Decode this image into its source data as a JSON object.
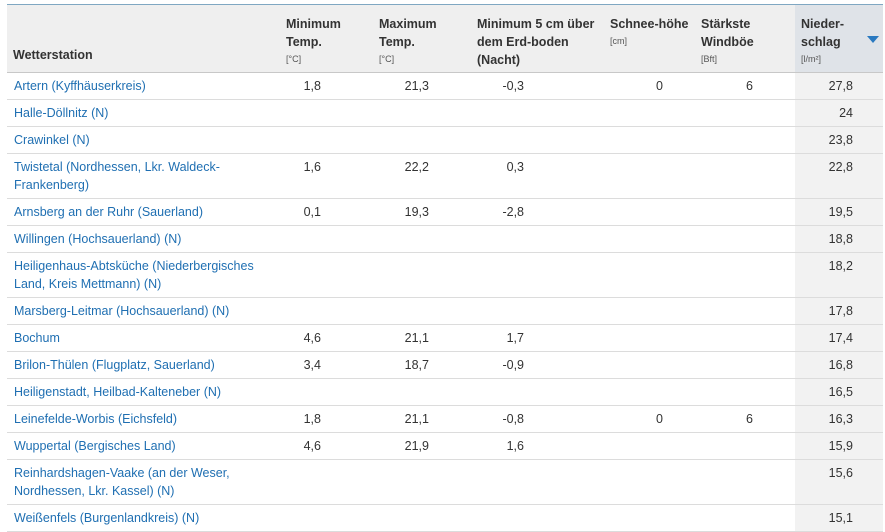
{
  "header": {
    "station": "Wetterstation",
    "min_temp": "Minimum Temp.",
    "min_temp_unit": "[°C]",
    "max_temp": "Maximum Temp.",
    "max_temp_unit": "[°C]",
    "min_5cm": "Minimum 5 cm über dem Erd-boden (Nacht)",
    "snow": "Schnee-höhe",
    "snow_unit": "[cm]",
    "wind": "Stärkste Windböe",
    "wind_unit": "[Bft]",
    "rain": "Nieder-schlag",
    "rain_unit": "[l/m²]",
    "sort_icon": "sort-descending-arrow",
    "colors": {
      "link": "#1f6fb2",
      "sort_arrow": "#2a79c0",
      "header_bg": "#efefef"
    }
  },
  "rows": [
    {
      "station": "Artern (Kyffhäuserkreis)",
      "min": "1,8",
      "max": "21,3",
      "min5": "-0,3",
      "snow": "0",
      "wind": "6",
      "rain": "27,8"
    },
    {
      "station": "Halle-Döllnitz (N)",
      "min": "",
      "max": "",
      "min5": "",
      "snow": "",
      "wind": "",
      "rain": "24"
    },
    {
      "station": "Crawinkel (N)",
      "min": "",
      "max": "",
      "min5": "",
      "snow": "",
      "wind": "",
      "rain": "23,8"
    },
    {
      "station": "Twistetal (Nordhessen, Lkr. Waldeck-Frankenberg)",
      "min": "1,6",
      "max": "22,2",
      "min5": "0,3",
      "snow": "",
      "wind": "",
      "rain": "22,8"
    },
    {
      "station": "Arnsberg an der Ruhr (Sauerland)",
      "min": "0,1",
      "max": "19,3",
      "min5": "-2,8",
      "snow": "",
      "wind": "",
      "rain": "19,5"
    },
    {
      "station": "Willingen (Hochsauerland) (N)",
      "min": "",
      "max": "",
      "min5": "",
      "snow": "",
      "wind": "",
      "rain": "18,8"
    },
    {
      "station": "Heiligenhaus-Abtsküche (Niederbergisches Land, Kreis Mettmann) (N)",
      "min": "",
      "max": "",
      "min5": "",
      "snow": "",
      "wind": "",
      "rain": "18,2"
    },
    {
      "station": "Marsberg-Leitmar (Hochsauerland) (N)",
      "min": "",
      "max": "",
      "min5": "",
      "snow": "",
      "wind": "",
      "rain": "17,8"
    },
    {
      "station": "Bochum",
      "min": "4,6",
      "max": "21,1",
      "min5": "1,7",
      "snow": "",
      "wind": "",
      "rain": "17,4"
    },
    {
      "station": "Brilon-Thülen (Flugplatz, Sauerland)",
      "min": "3,4",
      "max": "18,7",
      "min5": "-0,9",
      "snow": "",
      "wind": "",
      "rain": "16,8"
    },
    {
      "station": "Heiligenstadt, Heilbad-Kalteneber (N)",
      "min": "",
      "max": "",
      "min5": "",
      "snow": "",
      "wind": "",
      "rain": "16,5"
    },
    {
      "station": "Leinefelde-Worbis (Eichsfeld)",
      "min": "1,8",
      "max": "21,1",
      "min5": "-0,8",
      "snow": "0",
      "wind": "6",
      "rain": "16,3"
    },
    {
      "station": "Wuppertal (Bergisches Land)",
      "min": "4,6",
      "max": "21,9",
      "min5": "1,6",
      "snow": "",
      "wind": "",
      "rain": "15,9"
    },
    {
      "station": "Reinhardshagen-Vaake (an der Weser, Nordhessen, Lkr. Kassel) (N)",
      "min": "",
      "max": "",
      "min5": "",
      "snow": "",
      "wind": "",
      "rain": "15,6"
    },
    {
      "station": "Weißenfels (Burgenlandkreis) (N)",
      "min": "",
      "max": "",
      "min5": "",
      "snow": "",
      "wind": "",
      "rain": "15,1"
    }
  ]
}
